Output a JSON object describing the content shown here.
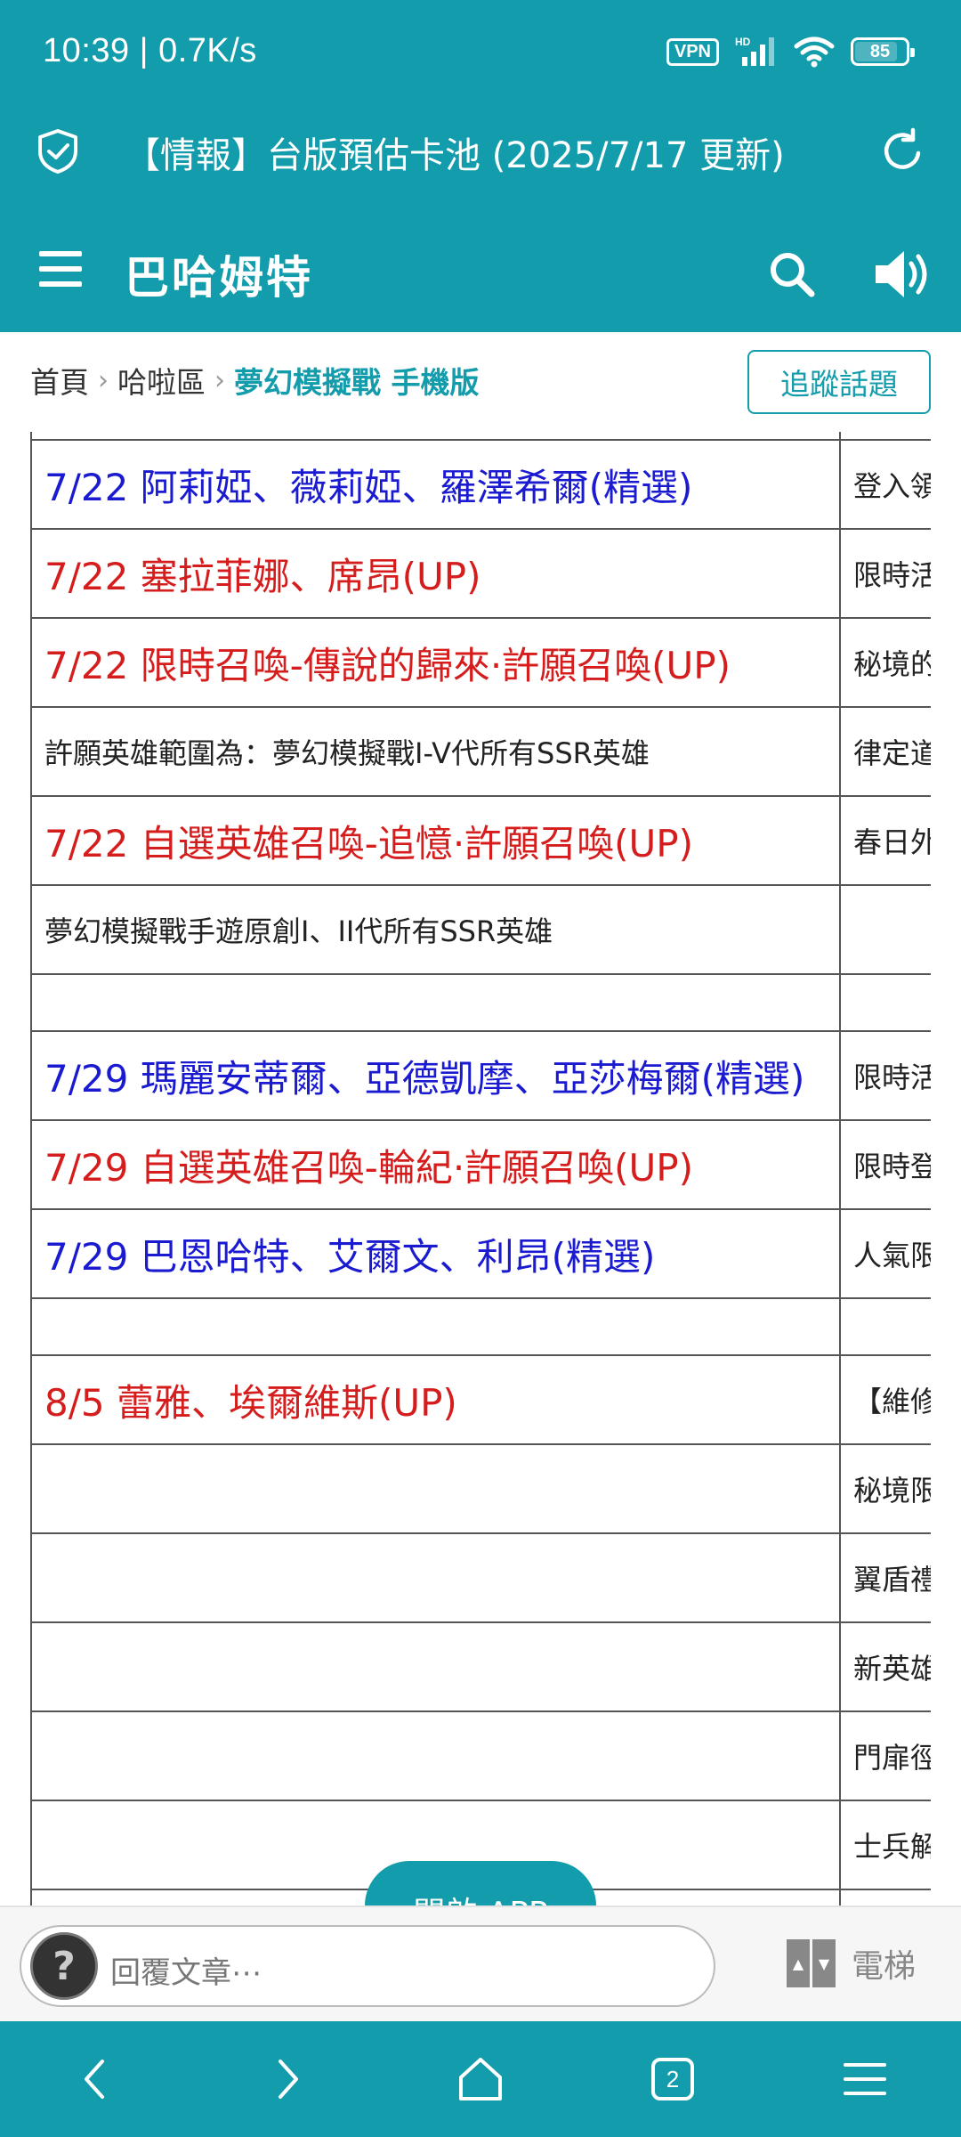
{
  "status_bar": {
    "time": "10:39 | 0.7K/s",
    "vpn": "VPN",
    "network": "HD",
    "battery": "85",
    "battery_level": 0.85
  },
  "browser": {
    "page_title": "【情報】台版預估卡池 (2025/7/17 更新)",
    "tab_count": "2"
  },
  "app": {
    "title": "巴哈姆特"
  },
  "breadcrumb": {
    "items": [
      "首頁",
      "哈啦區",
      "夢幻模擬戰 手機版"
    ],
    "follow_label": "追蹤話題"
  },
  "table": {
    "rows": [
      {
        "a": "",
        "b": "",
        "color": "plain"
      },
      {
        "a": "7/22 阿莉婭、薇莉婭、羅澤希爾(精選)",
        "b": "登入領",
        "color": "blue"
      },
      {
        "a": "7/22 塞拉菲娜、席昂(UP)",
        "b": "限時活",
        "color": "red"
      },
      {
        "a": "7/22 限時召喚-傳說的歸來·許願召喚(UP)",
        "b": "秘境的",
        "color": "red"
      },
      {
        "a": "許願英雄範圍為：夢幻模擬戰I-V代所有SSR英雄",
        "b": "律定道",
        "color": "plain"
      },
      {
        "a": "7/22 自選英雄召喚-追憶·許願召喚(UP)",
        "b": "春日外",
        "color": "red"
      },
      {
        "a": "夢幻模擬戰手遊原創I、II代所有SSR英雄",
        "b": "",
        "color": "plain"
      },
      {
        "a": "",
        "b": "",
        "color": "plain"
      },
      {
        "a": "7/29 瑪麗安蒂爾、亞德凱摩、亞莎梅爾(精選)",
        "b": "限時活",
        "color": "blue"
      },
      {
        "a": "7/29 自選英雄召喚-輪紀·許願召喚(UP)",
        "b": "限時登",
        "color": "red"
      },
      {
        "a": "7/29 巴恩哈特、艾爾文、利昂(精選)",
        "b": "人氣限",
        "color": "blue"
      },
      {
        "a": "",
        "b": "",
        "color": "plain"
      },
      {
        "a": "8/5 蕾雅、埃爾維斯(UP)",
        "b": "【維修",
        "color": "red"
      },
      {
        "a": "",
        "b": "秘境限",
        "color": "plain"
      },
      {
        "a": "",
        "b": "翼盾禮",
        "color": "plain"
      },
      {
        "a": "",
        "b": "新英雄",
        "color": "plain"
      },
      {
        "a": "",
        "b": "門扉徑",
        "color": "plain"
      },
      {
        "a": "",
        "b": "士兵解",
        "color": "plain"
      },
      {
        "a": "",
        "b": "",
        "color": "plain"
      }
    ]
  },
  "open_app_label": "開啟 APP",
  "reply": {
    "placeholder": "回覆文章⋯",
    "elevator_label": "電梯"
  },
  "colors": {
    "brand_teal": "#139cab",
    "link_blue": "#1a1ad0",
    "alert_red": "#d51d1d"
  }
}
